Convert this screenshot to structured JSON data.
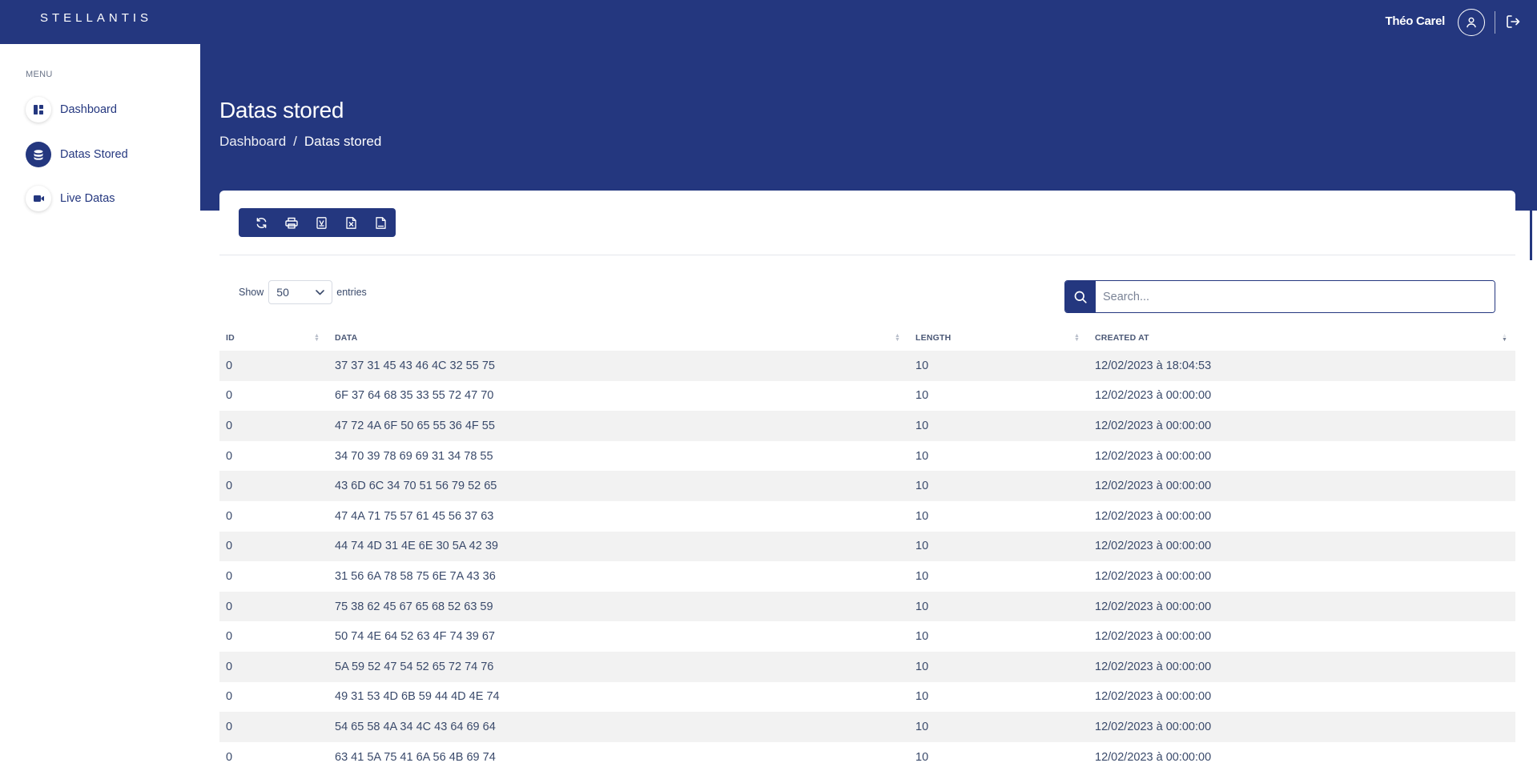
{
  "brand": {
    "logo_text": "STELLANTIS",
    "primary_color": "#24377f"
  },
  "header": {
    "user_name": "Théo Carel",
    "user_icon": "user-circle-icon",
    "logout_icon": "logout-icon"
  },
  "sidebar": {
    "menu_title": "MENU",
    "items": [
      {
        "label": "Dashboard",
        "icon": "dashboard-icon",
        "active": false
      },
      {
        "label": "Datas Stored",
        "icon": "database-icon",
        "active": true
      },
      {
        "label": "Live Datas",
        "icon": "video-icon",
        "active": false
      }
    ]
  },
  "page": {
    "title": "Datas stored",
    "breadcrumb": [
      "Dashboard",
      "Datas stored"
    ],
    "breadcrumb_separator": "/"
  },
  "toolbar": {
    "buttons": [
      "refresh-icon",
      "print-icon",
      "pdf-icon",
      "excel-icon",
      "csv-icon"
    ]
  },
  "table_controls": {
    "show_label": "Show",
    "entries_value": "50",
    "entries_label": "entries",
    "search_placeholder": "Search..."
  },
  "table": {
    "columns": [
      "ID",
      "DATA",
      "LENGTH",
      "CREATED AT"
    ],
    "rows": [
      {
        "id": "0",
        "data": "37 37 31 45 43 46 4C 32 55 75",
        "length": "10",
        "created_at": "12/02/2023 à 18:04:53"
      },
      {
        "id": "0",
        "data": "6F 37 64 68 35 33 55 72 47 70",
        "length": "10",
        "created_at": "12/02/2023 à 00:00:00"
      },
      {
        "id": "0",
        "data": "47 72 4A 6F 50 65 55 36 4F 55",
        "length": "10",
        "created_at": "12/02/2023 à 00:00:00"
      },
      {
        "id": "0",
        "data": "34 70 39 78 69 69 31 34 78 55",
        "length": "10",
        "created_at": "12/02/2023 à 00:00:00"
      },
      {
        "id": "0",
        "data": "43 6D 6C 34 70 51 56 79 52 65",
        "length": "10",
        "created_at": "12/02/2023 à 00:00:00"
      },
      {
        "id": "0",
        "data": "47 4A 71 75 57 61 45 56 37 63",
        "length": "10",
        "created_at": "12/02/2023 à 00:00:00"
      },
      {
        "id": "0",
        "data": "44 74 4D 31 4E 6E 30 5A 42 39",
        "length": "10",
        "created_at": "12/02/2023 à 00:00:00"
      },
      {
        "id": "0",
        "data": "31 56 6A 78 58 75 6E 7A 43 36",
        "length": "10",
        "created_at": "12/02/2023 à 00:00:00"
      },
      {
        "id": "0",
        "data": "75 38 62 45 67 65 68 52 63 59",
        "length": "10",
        "created_at": "12/02/2023 à 00:00:00"
      },
      {
        "id": "0",
        "data": "50 74 4E 64 52 63 4F 74 39 67",
        "length": "10",
        "created_at": "12/02/2023 à 00:00:00"
      },
      {
        "id": "0",
        "data": "5A 59 52 47 54 52 65 72 74 76",
        "length": "10",
        "created_at": "12/02/2023 à 00:00:00"
      },
      {
        "id": "0",
        "data": "49 31 53 4D 6B 59 44 4D 4E 74",
        "length": "10",
        "created_at": "12/02/2023 à 00:00:00"
      },
      {
        "id": "0",
        "data": "54 65 58 4A 34 4C 43 64 69 64",
        "length": "10",
        "created_at": "12/02/2023 à 00:00:00"
      },
      {
        "id": "0",
        "data": "63 41 5A 75 41 6A 56 4B 69 74",
        "length": "10",
        "created_at": "12/02/2023 à 00:00:00"
      }
    ]
  }
}
